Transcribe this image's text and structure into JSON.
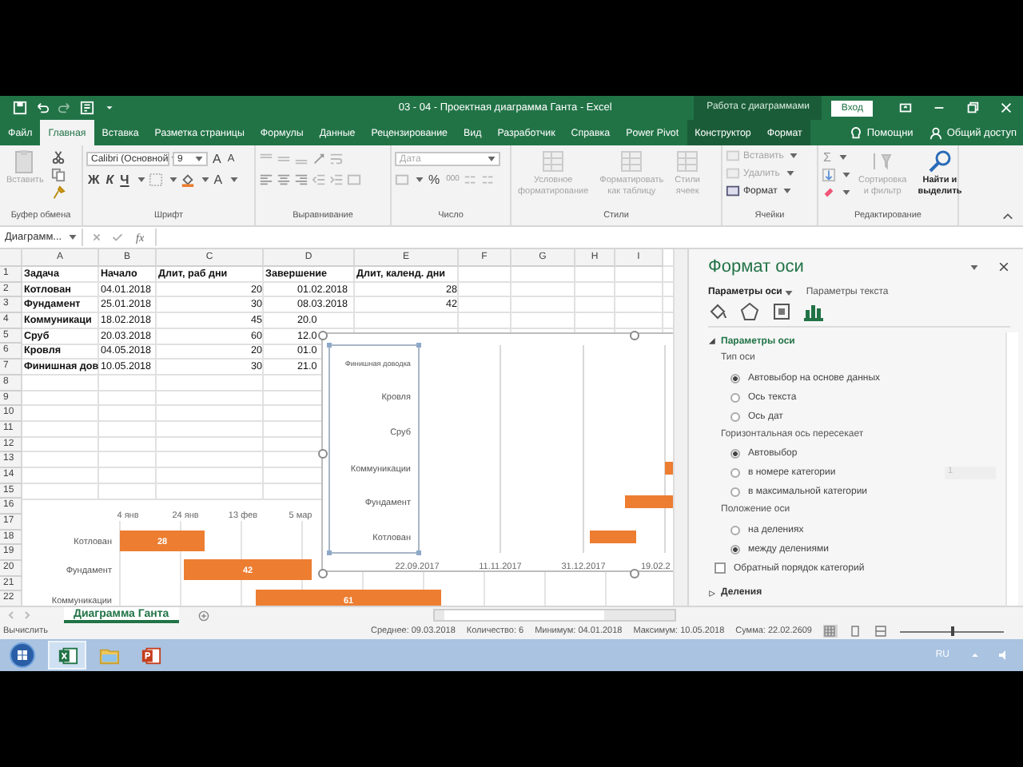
{
  "title_bar": {
    "title": "03 - 04 - Проектная диаграмма Ганта - Excel",
    "context": "Работа с диаграммами",
    "sign_in": "Вход"
  },
  "tabs": [
    {
      "label": "Файл",
      "selected": false,
      "kind": "normal"
    },
    {
      "label": "Главная",
      "selected": true,
      "kind": "normal"
    },
    {
      "label": "Вставка",
      "selected": false,
      "kind": "normal"
    },
    {
      "label": "Разметка страницы",
      "selected": false,
      "kind": "normal"
    },
    {
      "label": "Формулы",
      "selected": false,
      "kind": "normal"
    },
    {
      "label": "Данные",
      "selected": false,
      "kind": "normal"
    },
    {
      "label": "Рецензирование",
      "selected": false,
      "kind": "normal"
    },
    {
      "label": "Вид",
      "selected": false,
      "kind": "normal"
    },
    {
      "label": "Разработчик",
      "selected": false,
      "kind": "normal"
    },
    {
      "label": "Справка",
      "selected": false,
      "kind": "normal"
    },
    {
      "label": "Power Pivot",
      "selected": false,
      "kind": "normal"
    },
    {
      "label": "Конструктор",
      "selected": false,
      "kind": "context"
    },
    {
      "label": "Формат",
      "selected": false,
      "kind": "context"
    }
  ],
  "help": "Помощни",
  "share": "Общий доступ",
  "ribbon": {
    "clipboard": {
      "label": "Буфер обмена",
      "paste": "Вставить"
    },
    "font": {
      "label": "Шрифт",
      "family": "Calibri (Основной",
      "size": "9",
      "grow": "A",
      "shrink": "A",
      "bold": "Ж",
      "italic": "К",
      "underline": "Ч",
      "color_letter": "A"
    },
    "alignment": {
      "label": "Выравнивание"
    },
    "number": {
      "label": "Число",
      "format": "Дата",
      "percent": "%",
      "thousands": "000"
    },
    "styles": {
      "label": "Стили",
      "buttons": [
        {
          "lines": [
            "Условное",
            "форматирование"
          ],
          "disabled": true
        },
        {
          "lines": [
            "Форматировать",
            "как таблицу"
          ],
          "disabled": true
        },
        {
          "lines": [
            "Стили",
            "ячеек"
          ],
          "disabled": true
        }
      ]
    },
    "cells": {
      "label": "Ячейки",
      "buttons": [
        {
          "label": "Вставить",
          "disabled": true
        },
        {
          "label": "Удалить",
          "disabled": true
        },
        {
          "label": "Формат",
          "disabled": false
        }
      ]
    },
    "editing": {
      "label": "Редактирование",
      "sum": "Σ",
      "buttons": [
        {
          "lines": [
            "Сортировка",
            "и фильтр"
          ],
          "disabled": true
        },
        {
          "lines": [
            "Найти и",
            "выделить"
          ],
          "disabled": false
        }
      ]
    }
  },
  "formula_bar": {
    "name_box": "Диаграмм...",
    "fx": "fx"
  },
  "grid": {
    "columns": [
      "A",
      "B",
      "C",
      "D",
      "E",
      "F",
      "G",
      "H",
      "I"
    ],
    "rows": [
      {
        "number": "1",
        "cells": [
          "Задача",
          "Начало",
          "Длит, раб дни",
          "Завершение",
          "Длит, календ. дни"
        ]
      },
      {
        "number": "2",
        "cells": [
          "Котлован",
          "04.01.2018",
          "20",
          "01.02.2018",
          "28"
        ]
      },
      {
        "number": "3",
        "cells": [
          "Фундамент",
          "25.01.2018",
          "30",
          "08.03.2018",
          "42"
        ]
      },
      {
        "number": "4",
        "cells": [
          "Коммуникаци",
          "18.02.2018",
          "45",
          "20.0"
        ]
      },
      {
        "number": "5",
        "cells": [
          "Сруб",
          "20.03.2018",
          "60",
          "12.0"
        ]
      },
      {
        "number": "6",
        "cells": [
          "Кровля",
          "04.05.2018",
          "20",
          "01.0"
        ]
      },
      {
        "number": "7",
        "cells": [
          "Финишная дов",
          "10.05.2018",
          "30",
          "21.0"
        ]
      },
      {
        "number": "8",
        "cells": []
      },
      {
        "number": "9",
        "cells": []
      },
      {
        "number": "10",
        "cells": []
      },
      {
        "number": "11",
        "cells": []
      },
      {
        "number": "12",
        "cells": []
      },
      {
        "number": "13",
        "cells": []
      },
      {
        "number": "14",
        "cells": []
      },
      {
        "number": "15",
        "cells": []
      },
      {
        "number": "16",
        "cells": []
      },
      {
        "number": "17",
        "cells": []
      },
      {
        "number": "18",
        "cells": []
      },
      {
        "number": "19",
        "cells": []
      },
      {
        "number": "20",
        "cells": []
      },
      {
        "number": "21",
        "cells": []
      },
      {
        "number": "22",
        "cells": []
      }
    ]
  },
  "gantt_chart": {
    "axis_labels": [
      "4 янв",
      "24 янв",
      "13 фев",
      "5 мар"
    ],
    "categories": [
      "Котлован",
      "Фундамент",
      "Коммуникации"
    ],
    "bar_labels": [
      "28",
      "42",
      "61"
    ]
  },
  "selected_chart": {
    "categories": [
      "Финишная доводка",
      "Кровля",
      "Сруб",
      "Коммуникации",
      "Фундамент",
      "Котлован"
    ],
    "axis_labels": [
      "22.09.2017",
      "11.11.2017",
      "31.12.2017",
      "19.02.2"
    ]
  },
  "pane": {
    "title": "Формат оси",
    "tabs": [
      {
        "label": "Параметры оси",
        "selected": true
      },
      {
        "label": "Параметры текста",
        "selected": false
      }
    ],
    "icon_tabs": [
      {
        "kind": "fill",
        "selected": false
      },
      {
        "kind": "effects",
        "selected": false
      },
      {
        "kind": "size",
        "selected": false
      },
      {
        "kind": "axis",
        "selected": true
      }
    ],
    "section": {
      "title": "Параметры оси",
      "expanded": true,
      "groups": [
        {
          "label": "Тип оси",
          "options": [
            {
              "label": "Автовыбор на основе данных",
              "selected": true
            },
            {
              "label": "Ось текста",
              "selected": false
            },
            {
              "label": "Ось дат",
              "selected": false
            }
          ]
        },
        {
          "label": "Горизонтальная ось пересекает",
          "options": [
            {
              "label": "Автовыбор",
              "selected": true
            },
            {
              "label": "в номере категории",
              "selected": false,
              "input": "1"
            },
            {
              "label": "в максимальной категории",
              "selected": false
            }
          ]
        },
        {
          "label": "Положение оси",
          "options": [
            {
              "label": "на делениях",
              "selected": false
            },
            {
              "label": "между делениями",
              "selected": true
            }
          ]
        }
      ],
      "checkbox": {
        "label": "Обратный порядок категорий",
        "checked": false
      }
    },
    "next_section": {
      "title": "Деления",
      "expanded": false
    }
  },
  "sheet_tabs": [
    {
      "label": "Диаграмма Ганта",
      "selected": true
    }
  ],
  "status_bar": {
    "mode": "Вычислить",
    "stats": [
      "Среднее: 09.03.2018",
      "Количество: 6",
      "Минимум: 04.01.2018",
      "Максимум: 10.05.2018",
      "Сумма: 22.02.2609"
    ],
    "views": [
      {
        "kind": "normal",
        "selected": true
      },
      {
        "kind": "page_layout",
        "selected": false
      },
      {
        "kind": "page_break",
        "selected": false
      }
    ],
    "zoom": {
      "level": 0.5
    }
  },
  "taskbar": {
    "apps": [
      {
        "kind": "excel",
        "selected": true
      },
      {
        "kind": "explorer",
        "selected": false
      },
      {
        "kind": "powerpoint",
        "selected": false
      }
    ],
    "language": "RU"
  }
}
